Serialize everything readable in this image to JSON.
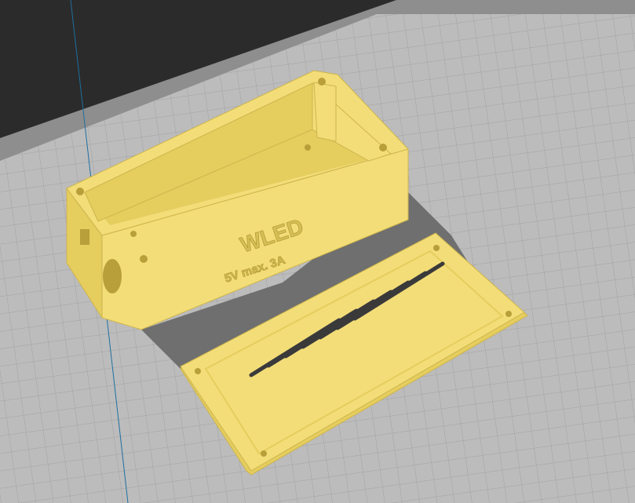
{
  "viewport": {
    "kind": "3d-slicer-viewport",
    "background_color": "#2b2b2b",
    "build_plate_color": "#8e8e8e",
    "build_plate_inner_color": "#bcbcbc",
    "grid_color": "#a2a2a2",
    "axis_line_color": "#1f6f9f",
    "model_color": "#f3dd78",
    "model_dark_color": "#e5cd5e",
    "model_shadow_color": "#6f6f6f"
  },
  "objects": [
    {
      "name": "enclosure-box",
      "embossed_text": [
        "WLED",
        "5V max. 3A"
      ]
    },
    {
      "name": "vented-lid",
      "vent_slot_count": 7
    }
  ]
}
